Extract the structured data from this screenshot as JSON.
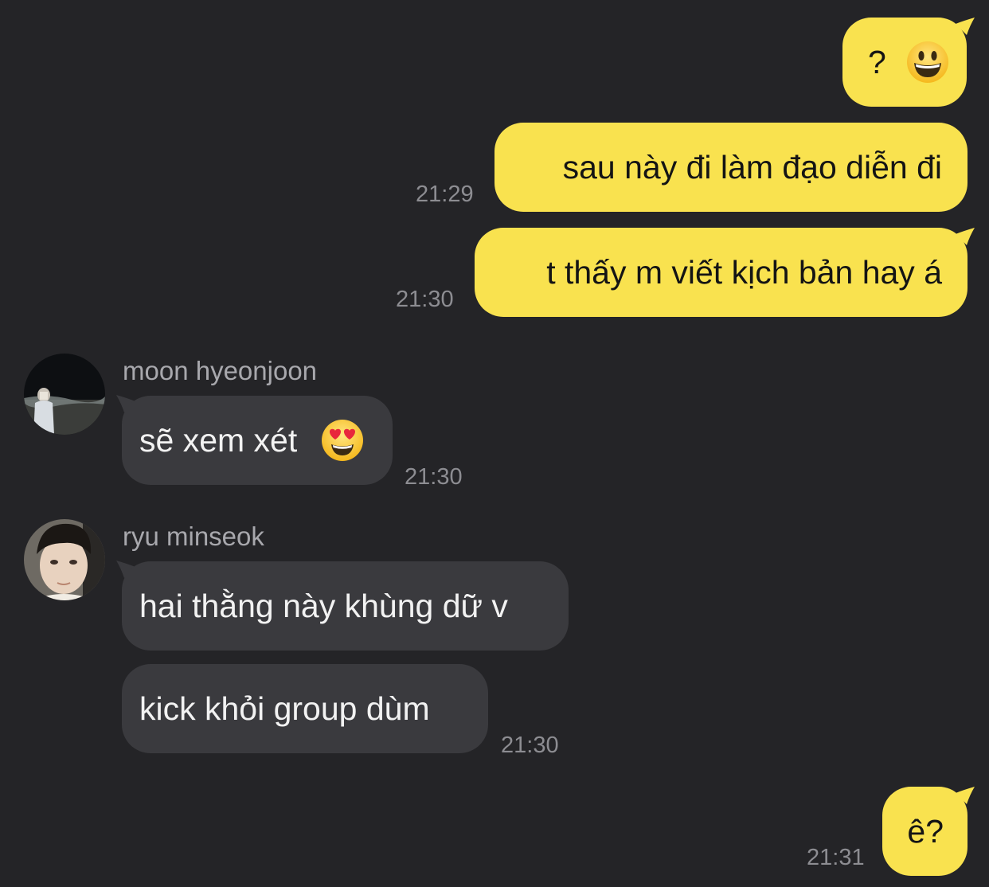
{
  "messages": [
    {
      "text": "?",
      "emoji": "grinning-face-emoji",
      "time": ""
    },
    {
      "text": "sau này đi làm đạo diễn đi",
      "time": "21:29"
    },
    {
      "text": "t thấy m viết kịch bản hay á",
      "time": "21:30"
    },
    {
      "sender": "moon hyeonjoon",
      "text": "sẽ xem xét",
      "emoji": "heart-eyes-emoji",
      "time": "21:30"
    },
    {
      "sender": "ryu minseok",
      "text": "hai thằng này khùng dữ v",
      "time": ""
    },
    {
      "text": "kick khỏi group dùm",
      "time": "21:30"
    },
    {
      "text": "ê?",
      "time": "21:31"
    }
  ],
  "colors": {
    "background": "#242427",
    "outgoing_bubble": "#f9e24f",
    "incoming_bubble": "#3a3a3e",
    "timestamp": "#8d8d92",
    "sender_name": "#a8a8ad"
  }
}
